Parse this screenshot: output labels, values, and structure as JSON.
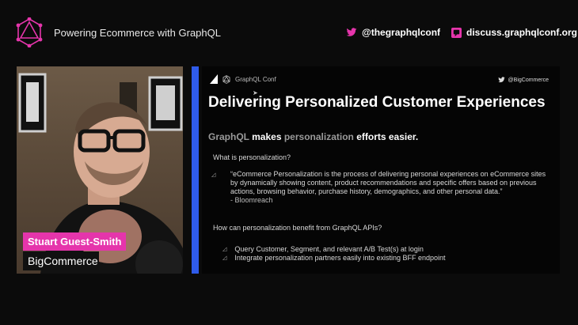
{
  "header": {
    "conference_title": "Powering Ecommerce with GraphQL",
    "twitter_handle": "@thegraphqlconf",
    "discuss_url": "discuss.graphqlconf.org"
  },
  "speaker": {
    "name": "Stuart Guest-Smith",
    "company": "BigCommerce"
  },
  "slide": {
    "brand_label": "GraphQL Conf",
    "twitter_handle": "@BigCommerce",
    "title": "Delivering Personalized Customer Experiences",
    "subtitle_prefix": "GraphQL",
    "subtitle_makes": " makes ",
    "subtitle_personalization": "personalization",
    "subtitle_suffix": " efforts easier.",
    "question1": "What is personalization?",
    "quote": "“eCommerce Personalization is the process of delivering personal experiences on eCommerce sites by dynamically showing content, product recommendations and specific offers based on previous actions, browsing behavior, purchase history, demographics, and other personal data.”",
    "quote_source": "- Bloomreach",
    "question2": "How can personalization benefit from GraphQL APIs?",
    "bullets": [
      "Query Customer, Segment, and relevant A/B Test(s) at login",
      "Integrate personalization partners easily into existing BFF endpoint"
    ]
  },
  "colors": {
    "accent_blue": "#2f5bea",
    "graphql_pink": "#e535ab",
    "twitter_pink": "#e535ab"
  },
  "icons": [
    "graphql-logo-icon",
    "twitter-icon",
    "discuss-icon",
    "bigcommerce-logo-icon"
  ]
}
